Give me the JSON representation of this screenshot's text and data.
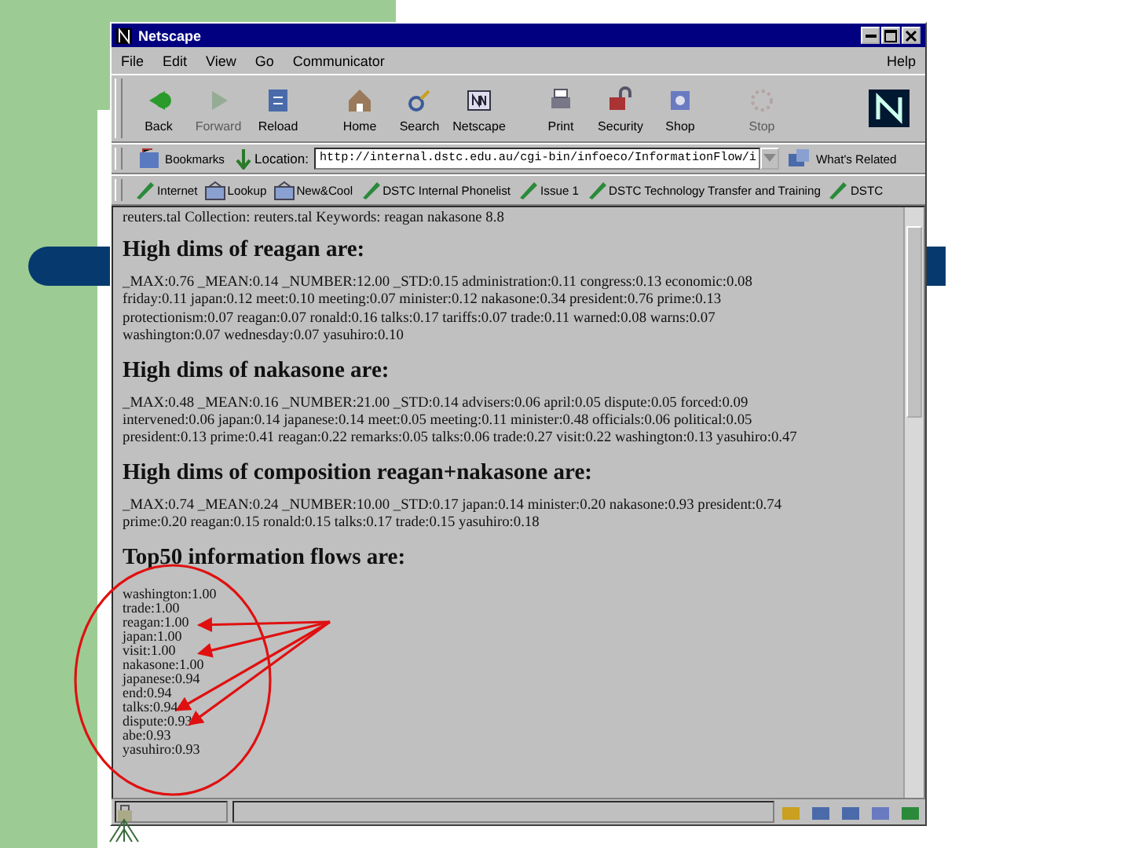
{
  "window": {
    "title": "Netscape"
  },
  "menu": {
    "left": [
      "File",
      "Edit",
      "View",
      "Go",
      "Communicator"
    ],
    "right": "Help"
  },
  "toolbar": [
    {
      "label": "Back",
      "disabled": false
    },
    {
      "label": "Forward",
      "disabled": true
    },
    {
      "label": "Reload",
      "disabled": false
    },
    {
      "label": "Home",
      "disabled": false
    },
    {
      "label": "Search",
      "disabled": false
    },
    {
      "label": "Netscape",
      "disabled": false
    },
    {
      "label": "Print",
      "disabled": false
    },
    {
      "label": "Security",
      "disabled": false
    },
    {
      "label": "Shop",
      "disabled": false
    },
    {
      "label": "Stop",
      "disabled": true
    }
  ],
  "location_bar": {
    "bookmarks": "Bookmarks",
    "location_label": "Location:",
    "url": "http://internal.dstc.edu.au/cgi-bin/infoeco/InformationFlow/i",
    "related": "What's Related"
  },
  "personal_bar": [
    "Internet",
    "Lookup",
    "New&Cool",
    "DSTC Internal Phonelist",
    "Issue 1",
    "DSTC Technology Transfer and Training",
    "DSTC"
  ],
  "content": {
    "intro": "reuters.tal Collection: reuters.tal Keywords: reagan nakasone 8.8",
    "sections": [
      {
        "heading": "High dims of reagan are:",
        "text": "_MAX:0.76 _MEAN:0.14 _NUMBER:12.00 _STD:0.15 administration:0.11 congress:0.13 economic:0.08 friday:0.11 japan:0.12 meet:0.10 meeting:0.07 minister:0.12 nakasone:0.34 president:0.76 prime:0.13 protectionism:0.07 reagan:0.07 ronald:0.16 talks:0.17 tariffs:0.07 trade:0.11 warned:0.08 warns:0.07 washington:0.07 wednesday:0.07 yasuhiro:0.10"
      },
      {
        "heading": "High dims of nakasone are:",
        "text": "_MAX:0.48 _MEAN:0.16 _NUMBER:21.00 _STD:0.14 advisers:0.06 april:0.05 dispute:0.05 forced:0.09 intervened:0.06 japan:0.14 japanese:0.14 meet:0.05 meeting:0.11 minister:0.48 officials:0.06 political:0.05 president:0.13 prime:0.41 reagan:0.22 remarks:0.05 talks:0.06 trade:0.27 visit:0.22 washington:0.13 yasuhiro:0.47"
      },
      {
        "heading": "High dims of composition reagan+nakasone are:",
        "text": "_MAX:0.74 _MEAN:0.24 _NUMBER:10.00 _STD:0.17 japan:0.14 minister:0.20 nakasone:0.93 president:0.74 prime:0.20 reagan:0.15 ronald:0.15 talks:0.17 trade:0.15 yasuhiro:0.18"
      }
    ],
    "flows_heading": "Top50 information flows are:",
    "flows": [
      "washington:1.00",
      "trade:1.00",
      "reagan:1.00",
      "japan:1.00",
      "visit:1.00",
      "nakasone:1.00",
      "japanese:0.94",
      "end:0.94",
      "talks:0.94",
      "dispute:0.93",
      "abe:0.93",
      "yasuhiro:0.93"
    ]
  }
}
